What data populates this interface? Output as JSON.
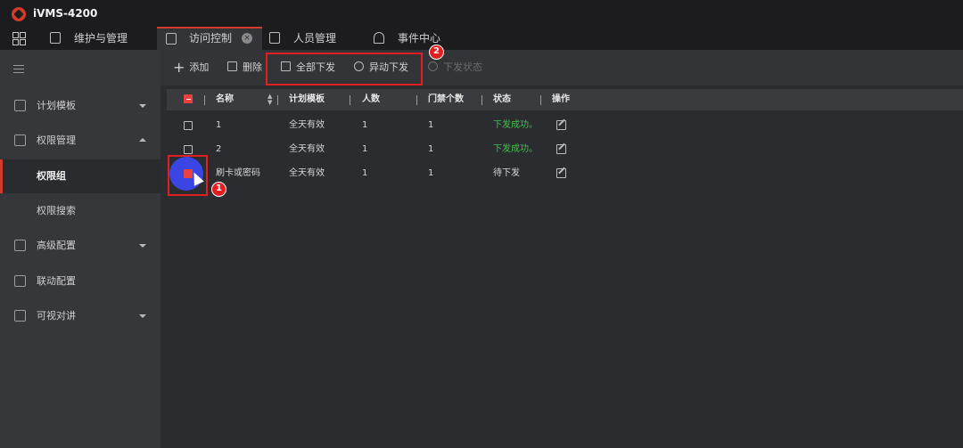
{
  "app": {
    "title": "iVMS-4200"
  },
  "tabs": [
    {
      "label": "维护与管理",
      "icon": "book-icon"
    },
    {
      "label": "访问控制",
      "icon": "door-icon",
      "active": true
    },
    {
      "label": "人员管理",
      "icon": "person-card-icon"
    },
    {
      "label": "事件中心",
      "icon": "alarm-icon"
    }
  ],
  "sidebar": {
    "items": [
      {
        "label": "计划模板",
        "icon": "edit-schedule-icon",
        "expand": "down"
      },
      {
        "label": "权限管理",
        "icon": "lock-icon",
        "expand": "up"
      },
      {
        "label": "权限组",
        "sub": true,
        "selected": true
      },
      {
        "label": "权限搜索",
        "sub": true
      },
      {
        "label": "高级配置",
        "icon": "advanced-icon",
        "expand": "down"
      },
      {
        "label": "联动配置",
        "icon": "linkage-icon"
      },
      {
        "label": "可视对讲",
        "icon": "intercom-icon",
        "expand": "down"
      }
    ]
  },
  "toolbar": {
    "add": "添加",
    "delete": "删除",
    "apply_all": "全部下发",
    "apply_changes": "异动下发",
    "apply_status": "下发状态"
  },
  "table": {
    "columns": [
      "名称",
      "计划模板",
      "人数",
      "门禁个数",
      "状态",
      "操作"
    ],
    "rows": [
      {
        "name": "1",
        "template": "全天有效",
        "people": "1",
        "doors": "1",
        "status": "下发成功。",
        "status_ok": true
      },
      {
        "name": "2",
        "template": "全天有效",
        "people": "1",
        "doors": "1",
        "status": "下发成功。",
        "status_ok": true
      },
      {
        "name": "刷卡或密码",
        "template": "全天有效",
        "people": "1",
        "doors": "1",
        "status": "待下发",
        "status_ok": false
      }
    ]
  },
  "annotations": {
    "step1": "1",
    "step2": "2"
  },
  "colors": {
    "accent": "#d23a2a",
    "success": "#3ec24a",
    "highlight": "#e02020",
    "click": "#3b45e3"
  }
}
